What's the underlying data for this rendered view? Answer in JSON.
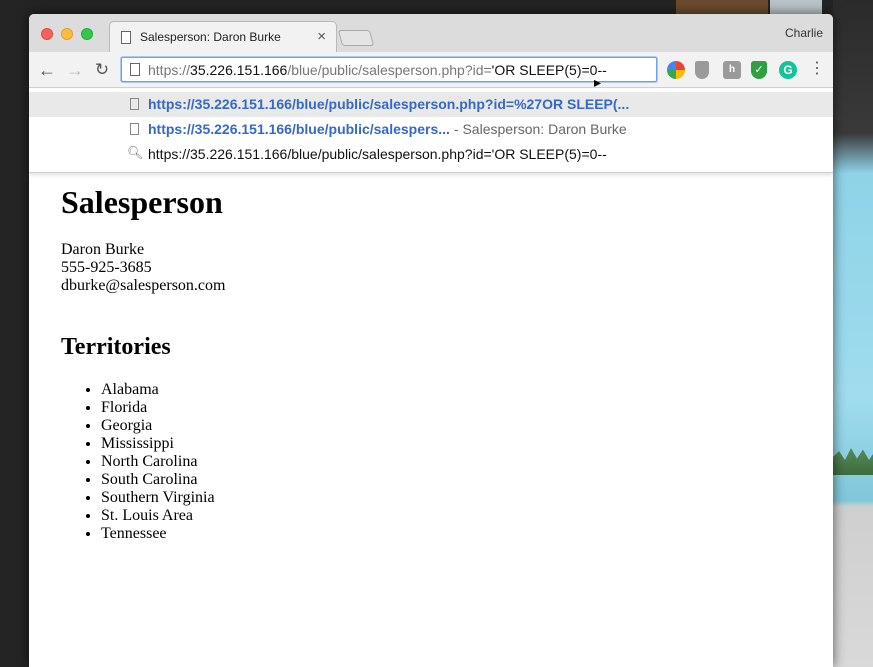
{
  "window": {
    "tab_title": "Salesperson: Daron Burke",
    "profile_name": "Charlie"
  },
  "address_bar": {
    "scheme": "https://",
    "host": "35.226.151.166",
    "path_before": "/blue/public/salesperson.php?id=",
    "path_after": "'OR SLEEP(5)=0--"
  },
  "suggestions": [
    {
      "link": "https://35.226.151.166/blue/public/salesperson.php?id=%27OR SLEEP(...",
      "desc": ""
    },
    {
      "link": "https://35.226.151.166/blue/public/salespers...",
      "desc": "- Salesperson: Daron Burke"
    },
    {
      "text": "https://35.226.151.166/blue/public/salesperson.php?id='OR SLEEP(5)=0--"
    }
  ],
  "page": {
    "title": "Salesperson",
    "name": "Daron Burke",
    "phone": "555-925-3685",
    "email": "dburke@salesperson.com",
    "territories_heading": "Territories",
    "territories": [
      "Alabama",
      "Florida",
      "Georgia",
      "Mississippi",
      "North Carolina",
      "South Carolina",
      "Southern Virginia",
      "St. Louis Area",
      "Tennessee"
    ]
  },
  "icons": [
    "page-icon",
    "close-icon",
    "back-icon",
    "forward-icon",
    "reload-icon",
    "search-icon",
    "menu-icon"
  ],
  "colors": {
    "link_blue": "#3468c9",
    "focus_blue": "#6ea2e8"
  }
}
